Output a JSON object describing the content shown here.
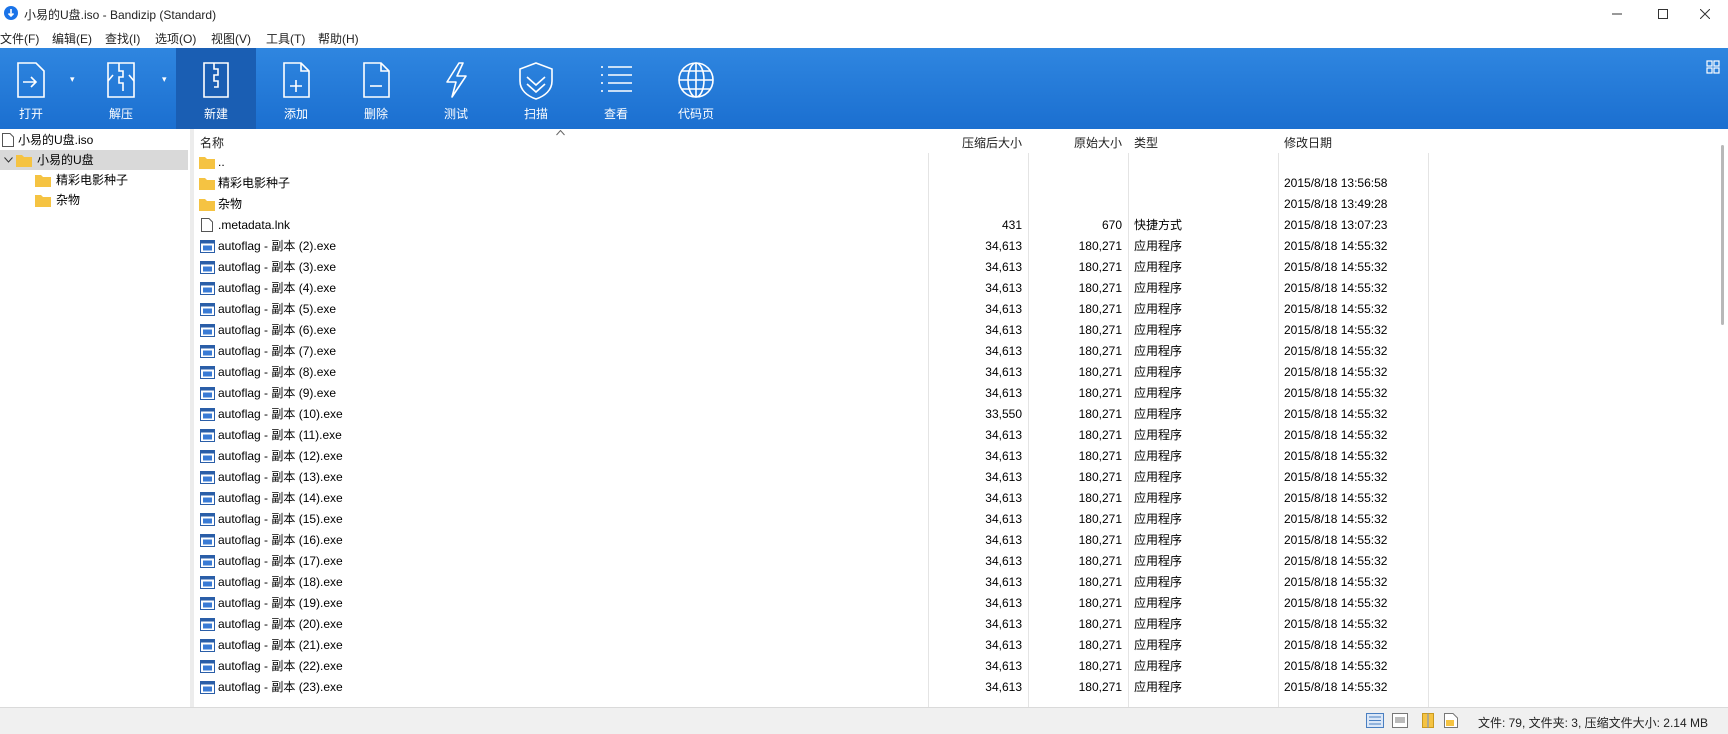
{
  "window": {
    "title": "小易的U盘.iso - Bandizip (Standard)"
  },
  "menu": [
    "文件(F)",
    "编辑(E)",
    "查找(I)",
    "选项(O)",
    "视图(V)",
    "工具(T)",
    "帮助(H)"
  ],
  "toolbar": {
    "open": "打开",
    "extract": "解压",
    "new": "新建",
    "add": "添加",
    "delete": "删除",
    "test": "测试",
    "scan": "扫描",
    "view": "查看",
    "codepage": "代码页"
  },
  "tree": {
    "root": "小易的U盘.iso",
    "folder": "小易的U盘",
    "children": [
      "精彩电影种子",
      "杂物"
    ]
  },
  "columns": {
    "name": "名称",
    "packed": "压缩后大小",
    "size": "原始大小",
    "type": "类型",
    "modified": "修改日期"
  },
  "files": [
    {
      "icon": "folder",
      "name": "..",
      "packed": "",
      "size": "",
      "type": "",
      "modified": ""
    },
    {
      "icon": "folder",
      "name": "精彩电影种子",
      "packed": "",
      "size": "",
      "type": "",
      "modified": "2015/8/18 13:56:58"
    },
    {
      "icon": "folder",
      "name": "杂物",
      "packed": "",
      "size": "",
      "type": "",
      "modified": "2015/8/18 13:49:28"
    },
    {
      "icon": "file",
      "name": ".metadata.lnk",
      "packed": "431",
      "size": "670",
      "type": "快捷方式",
      "modified": "2015/8/18 13:07:23"
    },
    {
      "icon": "exe",
      "name": "autoflag - 副本 (2).exe",
      "packed": "34,613",
      "size": "180,271",
      "type": "应用程序",
      "modified": "2015/8/18 14:55:32"
    },
    {
      "icon": "exe",
      "name": "autoflag - 副本 (3).exe",
      "packed": "34,613",
      "size": "180,271",
      "type": "应用程序",
      "modified": "2015/8/18 14:55:32"
    },
    {
      "icon": "exe",
      "name": "autoflag - 副本 (4).exe",
      "packed": "34,613",
      "size": "180,271",
      "type": "应用程序",
      "modified": "2015/8/18 14:55:32"
    },
    {
      "icon": "exe",
      "name": "autoflag - 副本 (5).exe",
      "packed": "34,613",
      "size": "180,271",
      "type": "应用程序",
      "modified": "2015/8/18 14:55:32"
    },
    {
      "icon": "exe",
      "name": "autoflag - 副本 (6).exe",
      "packed": "34,613",
      "size": "180,271",
      "type": "应用程序",
      "modified": "2015/8/18 14:55:32"
    },
    {
      "icon": "exe",
      "name": "autoflag - 副本 (7).exe",
      "packed": "34,613",
      "size": "180,271",
      "type": "应用程序",
      "modified": "2015/8/18 14:55:32"
    },
    {
      "icon": "exe",
      "name": "autoflag - 副本 (8).exe",
      "packed": "34,613",
      "size": "180,271",
      "type": "应用程序",
      "modified": "2015/8/18 14:55:32"
    },
    {
      "icon": "exe",
      "name": "autoflag - 副本 (9).exe",
      "packed": "34,613",
      "size": "180,271",
      "type": "应用程序",
      "modified": "2015/8/18 14:55:32"
    },
    {
      "icon": "exe",
      "name": "autoflag - 副本 (10).exe",
      "packed": "33,550",
      "size": "180,271",
      "type": "应用程序",
      "modified": "2015/8/18 14:55:32"
    },
    {
      "icon": "exe",
      "name": "autoflag - 副本 (11).exe",
      "packed": "34,613",
      "size": "180,271",
      "type": "应用程序",
      "modified": "2015/8/18 14:55:32"
    },
    {
      "icon": "exe",
      "name": "autoflag - 副本 (12).exe",
      "packed": "34,613",
      "size": "180,271",
      "type": "应用程序",
      "modified": "2015/8/18 14:55:32"
    },
    {
      "icon": "exe",
      "name": "autoflag - 副本 (13).exe",
      "packed": "34,613",
      "size": "180,271",
      "type": "应用程序",
      "modified": "2015/8/18 14:55:32"
    },
    {
      "icon": "exe",
      "name": "autoflag - 副本 (14).exe",
      "packed": "34,613",
      "size": "180,271",
      "type": "应用程序",
      "modified": "2015/8/18 14:55:32"
    },
    {
      "icon": "exe",
      "name": "autoflag - 副本 (15).exe",
      "packed": "34,613",
      "size": "180,271",
      "type": "应用程序",
      "modified": "2015/8/18 14:55:32"
    },
    {
      "icon": "exe",
      "name": "autoflag - 副本 (16).exe",
      "packed": "34,613",
      "size": "180,271",
      "type": "应用程序",
      "modified": "2015/8/18 14:55:32"
    },
    {
      "icon": "exe",
      "name": "autoflag - 副本 (17).exe",
      "packed": "34,613",
      "size": "180,271",
      "type": "应用程序",
      "modified": "2015/8/18 14:55:32"
    },
    {
      "icon": "exe",
      "name": "autoflag - 副本 (18).exe",
      "packed": "34,613",
      "size": "180,271",
      "type": "应用程序",
      "modified": "2015/8/18 14:55:32"
    },
    {
      "icon": "exe",
      "name": "autoflag - 副本 (19).exe",
      "packed": "34,613",
      "size": "180,271",
      "type": "应用程序",
      "modified": "2015/8/18 14:55:32"
    },
    {
      "icon": "exe",
      "name": "autoflag - 副本 (20).exe",
      "packed": "34,613",
      "size": "180,271",
      "type": "应用程序",
      "modified": "2015/8/18 14:55:32"
    },
    {
      "icon": "exe",
      "name": "autoflag - 副本 (21).exe",
      "packed": "34,613",
      "size": "180,271",
      "type": "应用程序",
      "modified": "2015/8/18 14:55:32"
    },
    {
      "icon": "exe",
      "name": "autoflag - 副本 (22).exe",
      "packed": "34,613",
      "size": "180,271",
      "type": "应用程序",
      "modified": "2015/8/18 14:55:32"
    },
    {
      "icon": "exe",
      "name": "autoflag - 副本 (23).exe",
      "packed": "34,613",
      "size": "180,271",
      "type": "应用程序",
      "modified": "2015/8/18 14:55:32"
    }
  ],
  "status": {
    "text": "文件: 79, 文件夹: 3, 压缩文件大小: 2.14 MB"
  },
  "colors": {
    "toolbar": "#1b6fd0",
    "toolbar_active": "#1a5eb3",
    "selection": "#d9d9d9",
    "folder": "#f5c342"
  }
}
